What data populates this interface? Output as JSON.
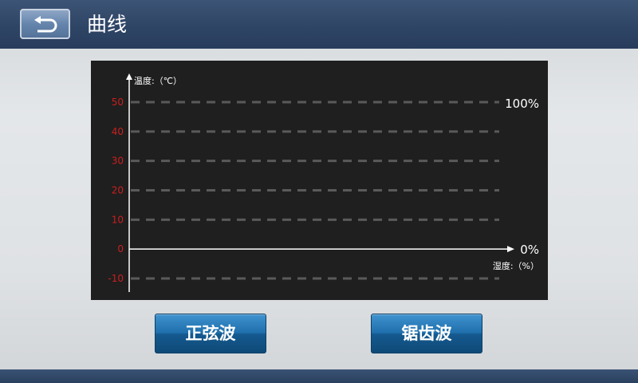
{
  "header": {
    "title": "曲线",
    "back_icon": "back-arrow-icon"
  },
  "chart": {
    "y_axis_label": "温度:（℃）",
    "x_axis_label": "湿度:（%）",
    "right_top_label": "100%",
    "right_bottom_label": "0%",
    "tick_color": "#cc1f1f"
  },
  "chart_data": {
    "type": "line",
    "title": "",
    "ylabel": "温度:（℃）",
    "xlabel": "湿度:（%）",
    "ylim": [
      -10,
      50
    ],
    "y_ticks": [
      50,
      40,
      30,
      20,
      10,
      0,
      -10
    ],
    "grid": true,
    "series": []
  },
  "buttons": {
    "sine": "正弦波",
    "sawtooth": "锯齿波"
  }
}
